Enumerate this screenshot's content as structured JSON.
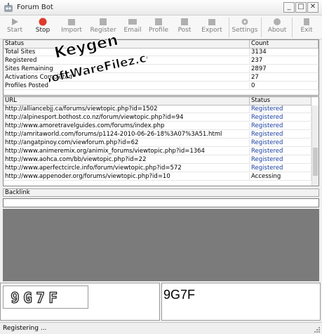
{
  "window": {
    "title": "Forum Bot"
  },
  "toolbar": {
    "buttons": [
      {
        "label": "Start",
        "icon": "play-icon"
      },
      {
        "label": "Stop",
        "icon": "stop-icon"
      },
      {
        "label": "Import",
        "icon": "import-icon"
      },
      {
        "label": "Register",
        "icon": "register-icon"
      },
      {
        "label": "Email",
        "icon": "email-icon"
      },
      {
        "label": "Profile",
        "icon": "profile-icon"
      },
      {
        "label": "Post",
        "icon": "post-icon"
      },
      {
        "label": "Export",
        "icon": "export-icon"
      },
      {
        "label": "Settings",
        "icon": "gear-icon"
      },
      {
        "label": "About",
        "icon": "info-icon"
      },
      {
        "label": "Exit",
        "icon": "exit-icon"
      }
    ]
  },
  "status_table": {
    "headers": [
      "Status",
      "Count"
    ],
    "rows": [
      {
        "status": "Total Sites",
        "count": "3134"
      },
      {
        "status": "Registered",
        "count": "237"
      },
      {
        "status": "Sites Remaining",
        "count": "2897"
      },
      {
        "status": "Activations Completed",
        "count": "27"
      },
      {
        "status": "Profiles Posted",
        "count": "0"
      }
    ]
  },
  "url_table": {
    "headers": [
      "URL",
      "Status"
    ],
    "rows": [
      {
        "url": "http://alliancebjj.ca/forums/viewtopic.php?id=1502",
        "status": "Registered"
      },
      {
        "url": "http://alpinesport.bothost.co.nz/forum/viewtopic.php?id=94",
        "status": "Registered"
      },
      {
        "url": "http://www.amoretravelguides.com/forums/index.php",
        "status": "Registered"
      },
      {
        "url": "http://amritaworld.com/forums/p1124-2010-06-26-18%3A07%3A51.html",
        "status": "Registered"
      },
      {
        "url": "http://angatpinoy.com/viewforum.php?id=62",
        "status": "Registered"
      },
      {
        "url": "http://www.animeremix.org/animix_forums/viewtopic.php?id=1364",
        "status": "Registered"
      },
      {
        "url": "http://www.aohca.com/bb/viewtopic.php?id=22",
        "status": "Registered"
      },
      {
        "url": "http://www.aperfectcircle.info/forum/viewtopic.php?id=572",
        "status": "Registered"
      },
      {
        "url": "http://www.appenoder.org/forums/viewtopic.php?id=10",
        "status": "Accessing"
      }
    ]
  },
  "backlink": {
    "label": "Backlink",
    "value": ""
  },
  "captcha": {
    "image_text": "9G7F",
    "answer": "9G7F"
  },
  "statusbar": {
    "text": "Registering ..."
  },
  "watermark": {
    "line1": "Keygen",
    "line2": "SoftWareFilez.com"
  }
}
